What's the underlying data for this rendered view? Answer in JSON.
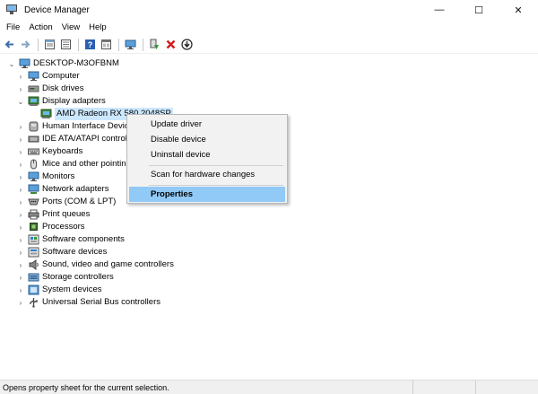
{
  "window": {
    "title": "Device Manager",
    "minimize_glyph": "—",
    "maximize_glyph": "☐",
    "close_glyph": "✕"
  },
  "menu": [
    "File",
    "Action",
    "View",
    "Help"
  ],
  "toolbar_icons": [
    "back-arrow-icon",
    "forward-arrow-icon",
    "properties-sheet-icon",
    "device-list-icon",
    "help-icon",
    "show-hidden-icon",
    "scan-monitor-icon",
    "enable-device-icon",
    "uninstall-x-icon",
    "update-driver-icon"
  ],
  "tree": {
    "root": "DESKTOP-M3OFBNM",
    "categories": [
      {
        "label": "Computer",
        "icon": "computer-icon",
        "expanded": false
      },
      {
        "label": "Disk drives",
        "icon": "disk-drive-icon",
        "expanded": false
      },
      {
        "label": "Display adapters",
        "icon": "display-adapter-icon",
        "expanded": true
      },
      {
        "label": "AMD Radeon RX 580 2048SP",
        "icon": "display-adapter-icon",
        "child": true,
        "selected": true
      },
      {
        "label": "Human Interface Devic",
        "icon": "hid-icon",
        "expanded": false
      },
      {
        "label": "IDE ATA/ATAPI control",
        "icon": "ide-controller-icon",
        "expanded": false
      },
      {
        "label": "Keyboards",
        "icon": "keyboard-icon",
        "expanded": false
      },
      {
        "label": "Mice and other pointin",
        "icon": "mouse-icon",
        "expanded": false
      },
      {
        "label": "Monitors",
        "icon": "monitor-icon",
        "expanded": false
      },
      {
        "label": "Network adapters",
        "icon": "network-adapter-icon",
        "expanded": false
      },
      {
        "label": "Ports (COM & LPT)",
        "icon": "port-icon",
        "expanded": false
      },
      {
        "label": "Print queues",
        "icon": "printer-icon",
        "expanded": false
      },
      {
        "label": "Processors",
        "icon": "processor-icon",
        "expanded": false
      },
      {
        "label": "Software components",
        "icon": "software-component-icon",
        "expanded": false
      },
      {
        "label": "Software devices",
        "icon": "software-device-icon",
        "expanded": false
      },
      {
        "label": "Sound, video and game controllers",
        "icon": "speaker-icon",
        "expanded": false
      },
      {
        "label": "Storage controllers",
        "icon": "storage-controller-icon",
        "expanded": false
      },
      {
        "label": "System devices",
        "icon": "system-device-icon",
        "expanded": false
      },
      {
        "label": "Universal Serial Bus controllers",
        "icon": "usb-icon",
        "expanded": false
      }
    ]
  },
  "context_menu": {
    "update_driver": "Update driver",
    "disable_device": "Disable device",
    "uninstall_device": "Uninstall device",
    "scan": "Scan for hardware changes",
    "properties": "Properties"
  },
  "status": {
    "text": "Opens property sheet for the current selection."
  },
  "colors": {
    "selection": "#cce8ff",
    "menu_highlight": "#91c9f7",
    "accent_blue": "#2a7fd4"
  }
}
